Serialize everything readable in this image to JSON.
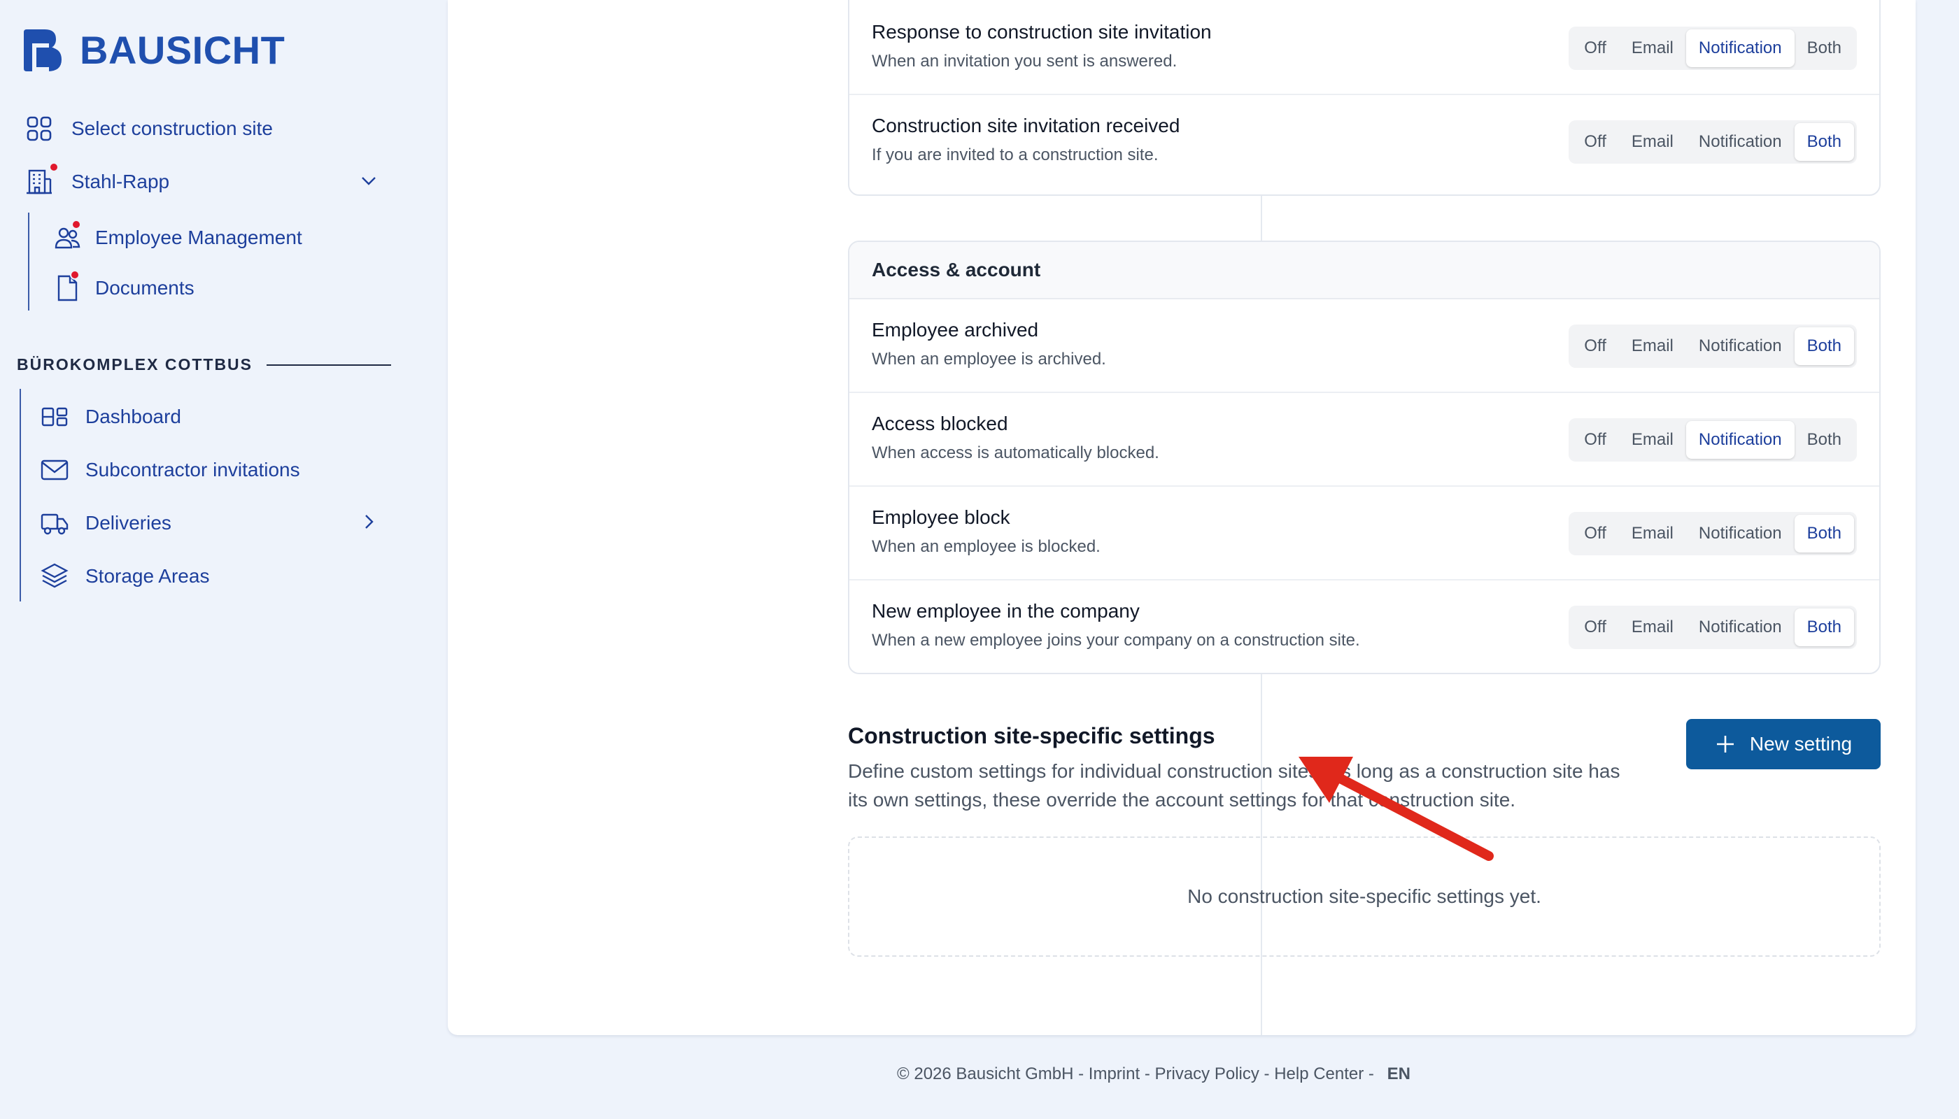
{
  "app": {
    "brand": "BAUSICHT"
  },
  "sidebar": {
    "top_items": [
      {
        "label": "Select construction site",
        "icon": "grid-icon"
      },
      {
        "label": "Stahl-Rapp",
        "icon": "building-icon"
      }
    ],
    "company_items": [
      {
        "label": "Employee Management",
        "icon": "users-icon"
      },
      {
        "label": "Documents",
        "icon": "document-icon"
      }
    ],
    "section_label": "BÜROKOMPLEX COTTBUS",
    "site_items": [
      {
        "label": "Dashboard",
        "icon": "dashboard-icon"
      },
      {
        "label": "Subcontractor invitations",
        "icon": "envelope-icon"
      },
      {
        "label": "Deliveries",
        "icon": "truck-icon"
      },
      {
        "label": "Storage Areas",
        "icon": "layers-icon"
      }
    ]
  },
  "options": [
    "Off",
    "Email",
    "Notification",
    "Both"
  ],
  "panel1": {
    "rows": [
      {
        "title": "Response to construction site invitation",
        "desc": "When an invitation you sent is answered.",
        "selected": "Notification"
      },
      {
        "title": "Construction site invitation received",
        "desc": "If you are invited to a construction site.",
        "selected": "Both"
      }
    ]
  },
  "panel2": {
    "heading": "Access & account",
    "rows": [
      {
        "title": "Employee archived",
        "desc": "When an employee is archived.",
        "selected": "Both"
      },
      {
        "title": "Access blocked",
        "desc": "When access is automatically blocked.",
        "selected": "Notification"
      },
      {
        "title": "Employee block",
        "desc": "When an employee is blocked.",
        "selected": "Both"
      },
      {
        "title": "New employee in the company",
        "desc": "When a new employee joins your company on a construction site.",
        "selected": "Both"
      }
    ]
  },
  "site_settings": {
    "title": "Construction site-specific settings",
    "desc": "Define custom settings for individual construction sites. As long as a construction site has its own settings, these override the account settings for that construction site.",
    "button": "New setting",
    "empty": "No construction site-specific settings yet."
  },
  "footer": {
    "copyright": "© 2026 Bausicht GmbH",
    "sep": " - ",
    "imprint": "Imprint",
    "privacy": "Privacy Policy",
    "help": "Help Center",
    "lang": "EN"
  },
  "colors": {
    "brand": "#1f4fae",
    "nav": "#1d3f9c",
    "button": "#0d5a9c",
    "alert_dot": "#e0182d",
    "annotation_arrow": "#e0281b"
  }
}
